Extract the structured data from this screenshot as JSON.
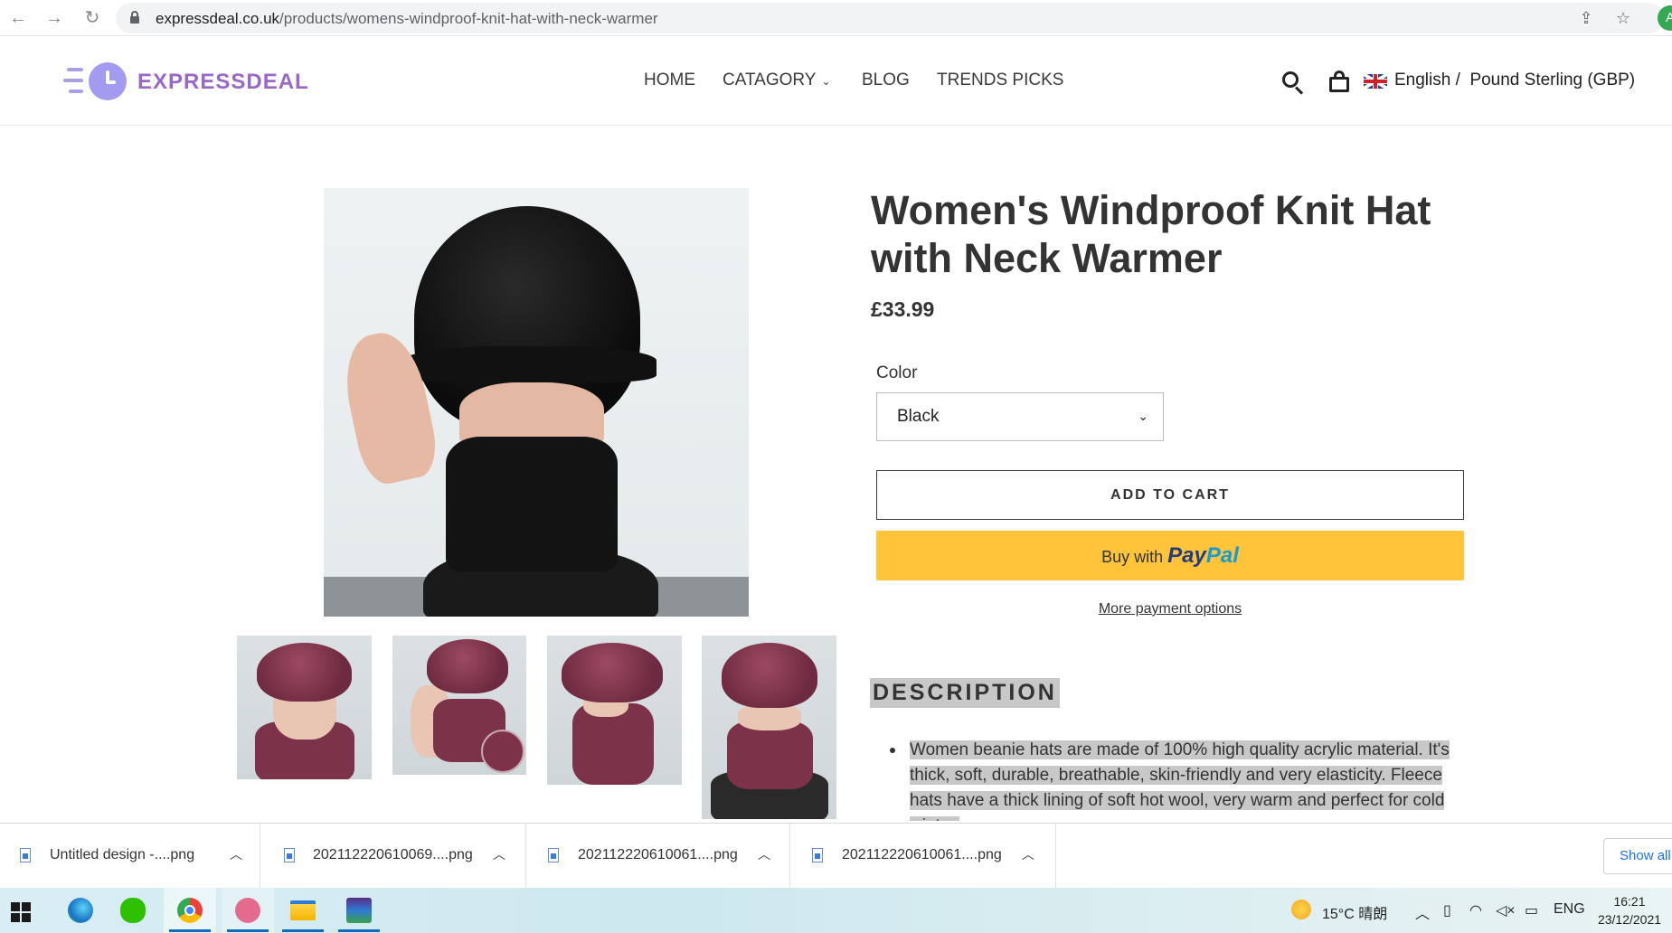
{
  "browser": {
    "url_domain": "expressdeal.co.uk",
    "url_path": "/products/womens-windproof-knit-hat-with-neck-warmer",
    "profile_initial": "A"
  },
  "store": {
    "logo_text": "EXPRESSDEAL",
    "nav": [
      {
        "label": "HOME"
      },
      {
        "label": "CATAGORY"
      },
      {
        "label": "BLOG"
      },
      {
        "label": "TRENDS PICKS"
      }
    ],
    "language": "English /",
    "currency": "Pound Sterling (GBP)"
  },
  "product": {
    "title": "Women's Windproof Knit Hat with Neck Warmer",
    "price": "£33.99",
    "option_label": "Color",
    "option_value": "Black",
    "add_to_cart": "ADD TO CART",
    "paypal_prefix": "Buy with",
    "paypal_brand_a": "Pay",
    "paypal_brand_b": "Pal",
    "more_payment": "More payment options",
    "description_heading": "DESCRIPTION",
    "description_text": "Women beanie hats are made of 100% high quality acrylic material. It's thick, soft, durable, breathable, skin-friendly and very elasticity. Fleece hats have a thick lining of soft hot wool, very warm and perfect for cold winter."
  },
  "downloads": {
    "items": [
      {
        "name": "Untitled design -....png"
      },
      {
        "name": "202112220610069....png"
      },
      {
        "name": "202112220610061....png"
      },
      {
        "name": "202112220610061....png"
      }
    ],
    "show_all": "Show all"
  },
  "taskbar": {
    "weather": "15°C 晴朗",
    "language": "ENG",
    "time": "16:21",
    "date": "23/12/2021"
  },
  "colors": {
    "paypal_yellow": "#ffc439",
    "logo_purple": "#9a68c8",
    "highlight": "#c8c8c8"
  }
}
